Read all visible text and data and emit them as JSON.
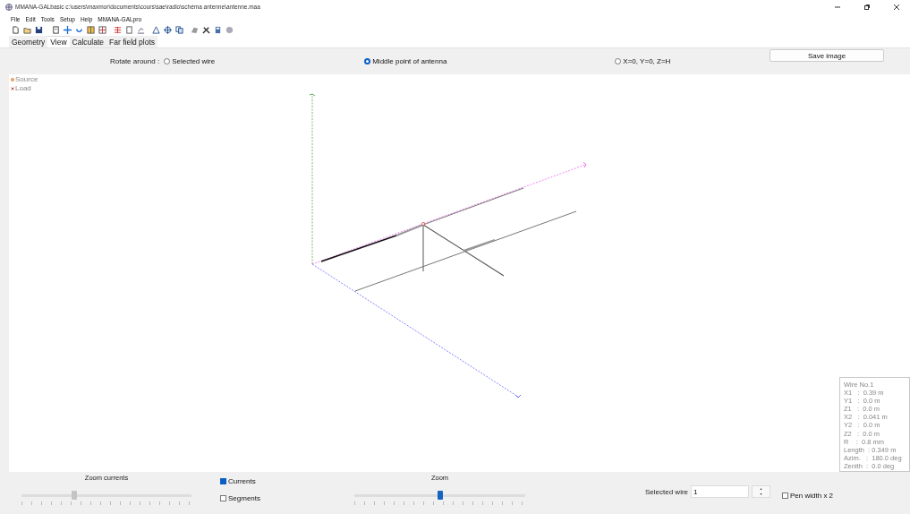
{
  "window": {
    "title": "MMANA-GALbasic c:\\users\\maxmor\\documents\\cours\\sae\\radio\\schéma antenne\\antenne.maa"
  },
  "menu": [
    "File",
    "Edit",
    "Tools",
    "Setup",
    "Help",
    "MMANA-GALpro"
  ],
  "tabs": [
    {
      "label": "Geometry",
      "selected": false
    },
    {
      "label": "View",
      "selected": true
    },
    {
      "label": "Calculate",
      "selected": false
    },
    {
      "label": "Far field plots",
      "selected": false
    }
  ],
  "rotate": {
    "label": "Rotate around :",
    "options": [
      {
        "label": "Selected wire",
        "selected": false
      },
      {
        "label": "Middle point of antenna",
        "selected": true
      },
      {
        "label": "X=0, Y=0, Z=H",
        "selected": false
      }
    ]
  },
  "save_button": "Save image",
  "legend": [
    {
      "kind": "source",
      "label": "Source"
    },
    {
      "kind": "load",
      "label": "Load"
    }
  ],
  "wire_info": [
    "Wire No.1",
    "X1   :  0.39 m",
    "Y1   :  0.0 m",
    "Z1   :  0.0 m",
    "X2   :  0.041 m",
    "Y2   :  0.0 m",
    "Z2   :  0.0 m",
    "R    :  0.8 mm",
    "Length  : 0.349 m",
    "Azim.   :  180.0 deg",
    "Zenith  :  0.0 deg"
  ],
  "zoom_currents": {
    "label": "Zoom currents",
    "level": 0.31
  },
  "checkboxes": [
    {
      "label": "Currents",
      "checked": true
    },
    {
      "label": "Segments",
      "checked": false
    }
  ],
  "zoom": {
    "label": "Zoom",
    "level": 0.5
  },
  "selected_wire": {
    "label": "Selected wire",
    "value": "1"
  },
  "pen_width": {
    "label": "Pen width x 2",
    "checked": false
  }
}
